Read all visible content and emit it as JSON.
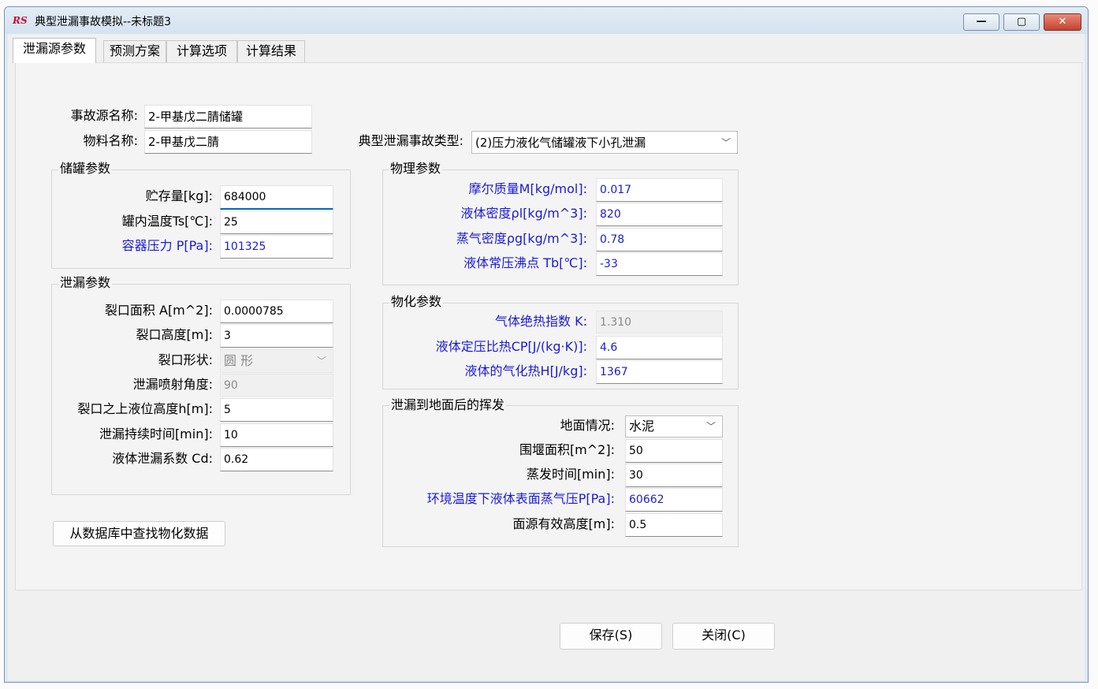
{
  "window": {
    "logo_text": "RS",
    "title": "典型泄漏事故模拟--未标题3",
    "min_glyph": "—",
    "max_glyph": "▢",
    "close_glyph": "✕"
  },
  "tabs": [
    "泄漏源参数",
    "预测方案",
    "计算选项",
    "计算结果"
  ],
  "top": {
    "source_label": "事故源名称:",
    "source_value": "2-甲基戊二腈储罐",
    "material_label": "物料名称:",
    "material_value": "2-甲基戊二腈",
    "type_label": "典型泄漏事故类型:",
    "type_value": "(2)压力液化气储罐液下小孔泄漏"
  },
  "tank": {
    "title": "储罐参数",
    "storage_label": "贮存量[kg]:",
    "storage_value": "684000",
    "temp_label": "罐内温度Ts[℃]:",
    "temp_value": "25",
    "pressure_label": "容器压力 P[Pa]:",
    "pressure_value": "101325"
  },
  "leak": {
    "title": "泄漏参数",
    "area_label": "裂口面积 A[m^2]:",
    "area_value": "0.0000785",
    "height_label": "裂口高度[m]:",
    "height_value": "3",
    "shape_label": "裂口形状:",
    "shape_value": "圆  形",
    "angle_label": "泄漏喷射角度:",
    "angle_value": "90",
    "level_label": "裂口之上液位高度h[m]:",
    "level_value": "5",
    "duration_label": "泄漏持续时间[min]:",
    "duration_value": "10",
    "coef_label": "液体泄漏系数  Cd:",
    "coef_value": "0.62"
  },
  "physical": {
    "title": "物理参数",
    "molar_label": "摩尔质量M[kg/mol]:",
    "molar_value": "0.017",
    "liquid_density_label": "液体密度ρl[kg/m^3]:",
    "liquid_density_value": "820",
    "vapor_density_label": "蒸气密度ρg[kg/m^3]:",
    "vapor_density_value": "0.78",
    "boiling_label": "液体常压沸点 Tb[℃]:",
    "boiling_value": "-33"
  },
  "chemical": {
    "title": "物化参数",
    "adiabatic_label": "气体绝热指数 K:",
    "adiabatic_value": "1.310",
    "cp_label": "液体定压比热CP[J/(kg·K)]:",
    "cp_value": "4.6",
    "heat_label": "液体的气化热H[J/kg]:",
    "heat_value": "1367"
  },
  "evap": {
    "title": "泄漏到地面后的挥发",
    "ground_label": "地面情况:",
    "ground_value": "水泥",
    "dike_label": "围堰面积[m^2]:",
    "dike_value": "50",
    "evap_time_label": "蒸发时间[min]:",
    "evap_time_value": "30",
    "vapor_pressure_label": "环境温度下液体表面蒸气压P[Pa]:",
    "vapor_pressure_value": "60662",
    "source_height_label": "面源有效高度[m]:",
    "source_height_value": "0.5"
  },
  "buttons": {
    "lookup": "从数据库中查找物化数据",
    "save": "保存(S)",
    "close": "关闭(C)"
  },
  "icons": {
    "dropdown": "chevron-down-icon"
  }
}
